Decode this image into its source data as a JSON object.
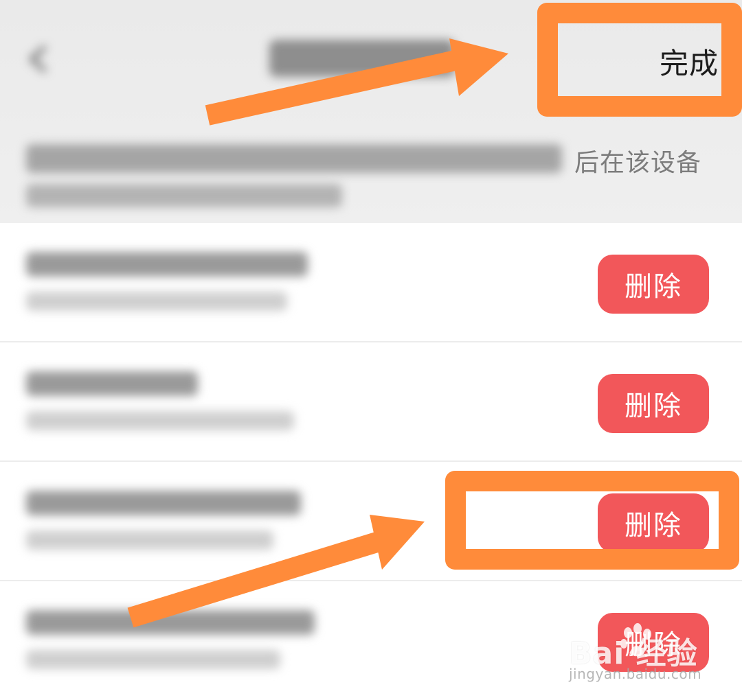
{
  "header": {
    "done_label": "完成",
    "description_visible_fragment": "后在该设备"
  },
  "devices": [
    {
      "delete_label": "删除"
    },
    {
      "delete_label": "删除"
    },
    {
      "delete_label": "删除"
    },
    {
      "delete_label": "删除"
    }
  ],
  "annotations": {
    "color": "#ff8b3a"
  },
  "watermark": {
    "brand": "Bai  经验",
    "url": "jingyan.baidu.com"
  },
  "colors": {
    "delete_button": "#f2575a",
    "header_background": "#ececec"
  }
}
